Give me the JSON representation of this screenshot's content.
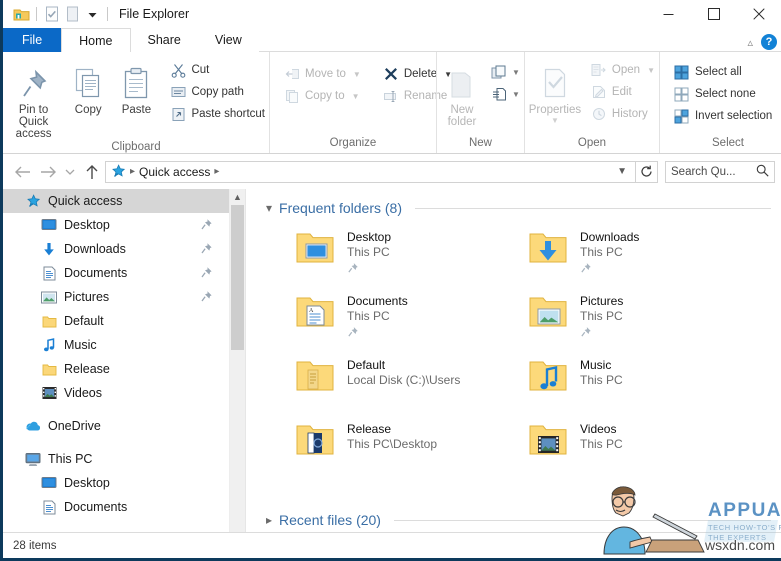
{
  "window": {
    "title": "File Explorer",
    "quick_access_toolbar": [
      {
        "name": "explorer-icon",
        "label": "File Explorer"
      },
      {
        "name": "properties-icon",
        "label": "Properties"
      },
      {
        "name": "new-folder-icon",
        "label": "New folder"
      },
      {
        "name": "customize-dropdown-icon",
        "label": "Customize Quick Access Toolbar"
      }
    ],
    "controls": {
      "minimize": "Minimize",
      "maximize": "Maximize",
      "close": "Close"
    }
  },
  "tabs": [
    {
      "label": "File",
      "state": "file"
    },
    {
      "label": "Home",
      "state": "active"
    },
    {
      "label": "Share",
      "state": "normal"
    },
    {
      "label": "View",
      "state": "normal"
    }
  ],
  "ribbon": {
    "collapse_label": "Minimize the Ribbon",
    "help_label": "?",
    "groups": [
      {
        "name": "clipboard",
        "label": "Clipboard",
        "big_buttons": [
          {
            "label": "Pin to Quick access",
            "icon": "pin-icon",
            "enabled": true
          },
          {
            "label": "Copy",
            "icon": "copy-icon",
            "enabled": true
          },
          {
            "label": "Paste",
            "icon": "paste-icon",
            "enabled": true
          }
        ],
        "small_buttons": [
          {
            "label": "Cut",
            "icon": "scissors-icon",
            "enabled": true
          },
          {
            "label": "Copy path",
            "icon": "copy-path-icon",
            "enabled": true
          },
          {
            "label": "Paste shortcut",
            "icon": "paste-shortcut-icon",
            "enabled": true
          }
        ]
      },
      {
        "name": "organize",
        "label": "Organize",
        "small_buttons": [
          {
            "label": "Move to",
            "icon": "move-to-icon",
            "enabled": false,
            "has_arrow": true
          },
          {
            "label": "Copy to",
            "icon": "copy-to-icon",
            "enabled": false,
            "has_arrow": true
          },
          {
            "label": "Delete",
            "icon": "delete-icon",
            "enabled": true,
            "has_arrow": true
          },
          {
            "label": "Rename",
            "icon": "rename-icon",
            "enabled": false
          }
        ]
      },
      {
        "name": "new",
        "label": "New",
        "big_buttons": [
          {
            "label": "New folder",
            "icon": "new-folder-icon",
            "enabled": false
          }
        ],
        "small_buttons": [
          {
            "label": "",
            "icon": "new-item-icon",
            "enabled": true,
            "has_arrow": true
          },
          {
            "label": "",
            "icon": "easy-access-icon",
            "enabled": true,
            "has_arrow": true
          }
        ]
      },
      {
        "name": "open",
        "label": "Open",
        "big_buttons": [
          {
            "label": "Properties",
            "icon": "properties-icon",
            "enabled": false,
            "has_arrow": true
          }
        ],
        "small_buttons": [
          {
            "label": "Open",
            "icon": "open-icon",
            "enabled": false,
            "has_arrow": true
          },
          {
            "label": "Edit",
            "icon": "edit-icon",
            "enabled": false
          },
          {
            "label": "History",
            "icon": "history-icon",
            "enabled": false
          }
        ]
      },
      {
        "name": "select",
        "label": "Select",
        "small_buttons": [
          {
            "label": "Select all",
            "icon": "select-all-icon",
            "enabled": true
          },
          {
            "label": "Select none",
            "icon": "select-none-icon",
            "enabled": true
          },
          {
            "label": "Invert selection",
            "icon": "invert-selection-icon",
            "enabled": true
          }
        ]
      }
    ]
  },
  "addressbar": {
    "back_label": "Back",
    "forward_label": "Forward",
    "recent_label": "Recent locations",
    "up_label": "Up",
    "breadcrumb_icon": "quick-access-star-icon",
    "breadcrumb": "Quick access",
    "dropdown_label": "Previous locations",
    "refresh_label": "Refresh",
    "search": {
      "placeholder": "Search Qu...",
      "icon": "search-icon"
    }
  },
  "navpane": {
    "items": [
      {
        "label": "Quick access",
        "icon": "quick-access-star-icon",
        "level": 1,
        "selected": true,
        "pinned": false
      },
      {
        "label": "Desktop",
        "icon": "desktop-icon",
        "level": 2,
        "selected": false,
        "pinned": true
      },
      {
        "label": "Downloads",
        "icon": "downloads-icon",
        "level": 2,
        "selected": false,
        "pinned": true
      },
      {
        "label": "Documents",
        "icon": "documents-icon",
        "level": 2,
        "selected": false,
        "pinned": true
      },
      {
        "label": "Pictures",
        "icon": "pictures-icon",
        "level": 2,
        "selected": false,
        "pinned": true
      },
      {
        "label": "Default",
        "icon": "folder-icon",
        "level": 2,
        "selected": false,
        "pinned": false
      },
      {
        "label": "Music",
        "icon": "music-icon",
        "level": 2,
        "selected": false,
        "pinned": false
      },
      {
        "label": "Release",
        "icon": "folder-icon",
        "level": 2,
        "selected": false,
        "pinned": false
      },
      {
        "label": "Videos",
        "icon": "videos-icon",
        "level": 2,
        "selected": false,
        "pinned": false
      },
      {
        "label": "OneDrive",
        "icon": "onedrive-icon",
        "level": 1,
        "selected": false,
        "pinned": false,
        "gap_before": true
      },
      {
        "label": "This PC",
        "icon": "this-pc-icon",
        "level": 1,
        "selected": false,
        "pinned": false,
        "gap_before": true
      },
      {
        "label": "Desktop",
        "icon": "desktop-icon",
        "level": 2,
        "selected": false,
        "pinned": false
      },
      {
        "label": "Documents",
        "icon": "documents-icon",
        "level": 2,
        "selected": false,
        "pinned": false
      }
    ],
    "scrollbar": {
      "up": "Scroll up",
      "down": "Scroll down"
    }
  },
  "content": {
    "sections": [
      {
        "name": "frequent-folders",
        "title": "Frequent folders (8)",
        "expanded": true,
        "twisty": "chevron-down-icon"
      },
      {
        "name": "recent-files",
        "title": "Recent files (20)",
        "expanded": false,
        "twisty": "chevron-right-icon"
      }
    ],
    "frequent_folders": [
      {
        "name": "Desktop",
        "location": "This PC",
        "icon": "folder-desktop-icon",
        "pinned": true
      },
      {
        "name": "Downloads",
        "location": "This PC",
        "icon": "folder-downloads-icon",
        "pinned": true
      },
      {
        "name": "Documents",
        "location": "This PC",
        "icon": "folder-documents-icon",
        "pinned": true
      },
      {
        "name": "Pictures",
        "location": "This PC",
        "icon": "folder-pictures-icon",
        "pinned": true
      },
      {
        "name": "Default",
        "location": "Local Disk (C:)\\Users",
        "icon": "folder-default-icon",
        "pinned": false
      },
      {
        "name": "Music",
        "location": "This PC",
        "icon": "folder-music-icon",
        "pinned": false
      },
      {
        "name": "Release",
        "location": "This PC\\Desktop",
        "icon": "folder-release-icon",
        "pinned": false
      },
      {
        "name": "Videos",
        "location": "This PC",
        "icon": "folder-videos-icon",
        "pinned": false
      }
    ]
  },
  "statusbar": {
    "item_count": "28 items"
  },
  "watermark": {
    "brand": "APPUALS",
    "tagline": "TECH HOW-TO'S FROM THE EXPERTS",
    "url": "wsxdn.com"
  },
  "colors": {
    "accent": "#0b69c7",
    "section_title": "#3a6ea5",
    "window_border": "#0d3a5c",
    "selection": "#d6d6d6",
    "folder_yellow": "#fcd97a",
    "folder_yellow_dark": "#e8bd52"
  }
}
